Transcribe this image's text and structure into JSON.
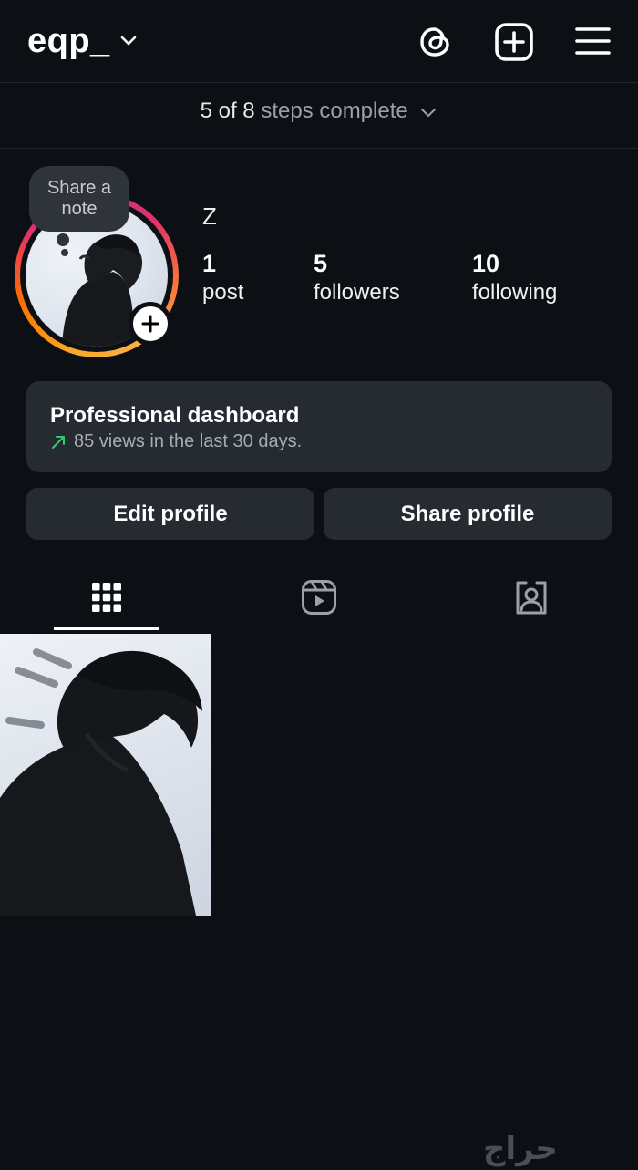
{
  "header": {
    "username": "eqp_",
    "icons": [
      "threads-icon",
      "new-post-icon",
      "menu-icon"
    ]
  },
  "steps": {
    "count": "5 of 8",
    "label": "steps complete"
  },
  "profile": {
    "note_label_line1": "Share a",
    "note_label_line2": "note",
    "display_name": "Z",
    "stats": {
      "posts": {
        "value": "1",
        "label": "post"
      },
      "followers": {
        "value": "5",
        "label": "followers"
      },
      "following": {
        "value": "10",
        "label": "following"
      }
    }
  },
  "dashboard": {
    "title": "Professional dashboard",
    "subtitle": "85 views in the last 30 days."
  },
  "actions": {
    "edit": "Edit profile",
    "share": "Share profile"
  },
  "tabs": [
    {
      "name": "posts-grid",
      "icon": "grid-icon",
      "active": true
    },
    {
      "name": "reels",
      "icon": "reels-icon",
      "active": false
    },
    {
      "name": "tagged",
      "icon": "tagged-icon",
      "active": false
    }
  ],
  "watermark": "حراج",
  "colors": {
    "background": "#0c0f14",
    "card": "#262a31",
    "trend_green": "#2ecc71"
  }
}
